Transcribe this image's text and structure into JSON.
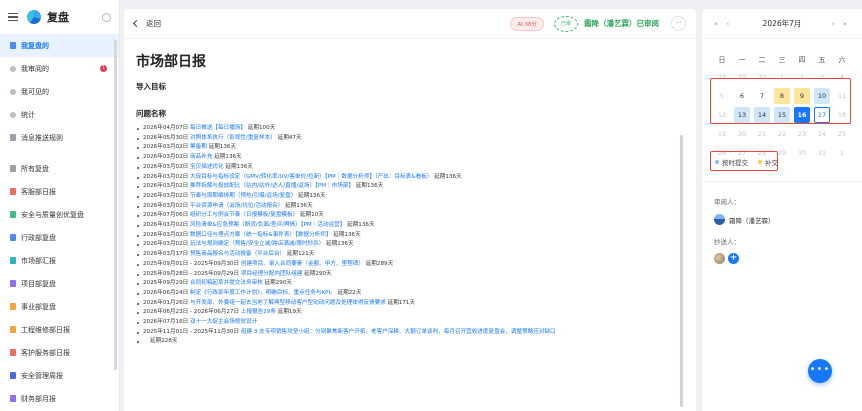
{
  "sidebar": {
    "title": "复盘",
    "items": [
      {
        "label": "我复盘的",
        "icon": "user-icon",
        "active": true
      },
      {
        "label": "我审阅的",
        "icon": "review-icon",
        "badge": "1"
      },
      {
        "label": "我可见的",
        "icon": "eye-icon"
      },
      {
        "label": "统计",
        "icon": "stats-icon"
      },
      {
        "label": "消息推送规则",
        "icon": "message-icon"
      }
    ],
    "groups": [
      {
        "label": "所有复盘",
        "icon": "grid-icon",
        "color": "gray"
      },
      {
        "label": "客服部日报",
        "icon": "doc-icon",
        "color": "red"
      },
      {
        "label": "安全与质量创优复盘",
        "icon": "doc-icon",
        "color": "green"
      },
      {
        "label": "行政部复盘",
        "icon": "doc-icon",
        "color": "blue"
      },
      {
        "label": "市场部汇报",
        "icon": "doc-icon",
        "color": "teal"
      },
      {
        "label": "项目部复盘",
        "icon": "doc-icon",
        "color": "purple"
      },
      {
        "label": "事业部复盘",
        "icon": "doc-icon",
        "color": "orange"
      },
      {
        "label": "工程维修部日报",
        "icon": "doc-icon",
        "color": "orange"
      },
      {
        "label": "客护服务部日报",
        "icon": "doc-icon",
        "color": "red"
      },
      {
        "label": "安全管理周报",
        "icon": "doc-icon",
        "color": "navy"
      },
      {
        "label": "财务部月报",
        "icon": "doc-icon",
        "color": "purple"
      }
    ]
  },
  "topbar": {
    "back_label": "返回",
    "ai_chip": "AI 38分",
    "stamp": "已审",
    "approved_text": "霜降（潘艺霖）已审阅",
    "more": "···"
  },
  "doc": {
    "title": "市场部日报",
    "section1": "导入目标",
    "section2": "问题名称",
    "items": [
      {
        "date": "2026年04月07日",
        "link": "每日推送【每日播场】",
        "delay": "延期100天"
      },
      {
        "date": "2026年05月30日",
        "link": "对照体系执行（影视性/重复样本）",
        "delay": "延期47天"
      },
      {
        "date": "2026年03月02日",
        "link": "筹备期",
        "delay": "延期136天"
      },
      {
        "date": "2026年03月02日",
        "link": "商品补充",
        "delay": "延期136天"
      },
      {
        "date": "2026年03月02日",
        "link": "宝贝描述优化",
        "delay": "延期136天"
      },
      {
        "date": "2026年03月02日",
        "link": "大促目标与指标设定（GMV/转化率/UV/客单价/拉新）【PM｜数据分析师】（产出：目标表&看板）",
        "delay": "延期136天"
      },
      {
        "date": "2026年03月02日",
        "link": "推荐拆解与投放配比（站内/站外/达人/直播/返场）【PM｜市场部】",
        "delay": "延期136天"
      },
      {
        "date": "2026年03月02日",
        "link": "节奏与周期编排期（预热/引爆/返场/复盘）",
        "delay": "延期136天"
      },
      {
        "date": "2026年03月02日",
        "link": "平台资源申请（会场/坑位/活动报名）",
        "delay": "延期136天"
      },
      {
        "date": "2026年07月06日",
        "link": "组织分工与例会节奏（日报模板/复盘模板）",
        "delay": "延期10天"
      },
      {
        "date": "2026年03月02日",
        "link": "风险清单&应急预案（断货/负面/差评/舆情）【PM｜活动运营】",
        "delay": "延期136天"
      },
      {
        "date": "2026年03月02日",
        "link": "数据口径与埋点方案（统一指标&事件表）【数据分析师】",
        "delay": "延期136天"
      },
      {
        "date": "2026年03月02日",
        "link": "玩法与规则确定（预售/安全立减/跨店满减/限时秒杀）",
        "delay": "延期136天"
      },
      {
        "date": "2026年03月17日",
        "link": "预售商品报名与活动报备（平台后台）",
        "delay": "延期121天"
      },
      {
        "date": "2025年09月01日 - 2025年09月30日",
        "link": "创建项目、录入合同要素（金额、甲方、里程碑）",
        "delay": "延期289天"
      },
      {
        "date": "2025年09月28日 - 2025年09月29日",
        "link": "项目经理分配内团队组建",
        "delay": "延期290天"
      },
      {
        "date": "2025年09月29日",
        "link": "合同初稿起草并提交法务审核",
        "delay": "延期290天"
      },
      {
        "date": "2026年06月24日",
        "link": "制定《行政部年度工作计划》，明确目标、重点任务与KPI。",
        "delay": "延期22天"
      },
      {
        "date": "2026年01月26日",
        "link": "与开发部、外委组一起去当地了解典型移动客户型动动问题及处理体得反馈要求",
        "delay": "延期171天"
      },
      {
        "date": "2026年06月23日 - 2026年06月27日",
        "link": "上报报告29条",
        "delay": "延期19天"
      },
      {
        "date": "2026年07月16日",
        "link": "双十一大促主会场视觉设计",
        "delay": ""
      },
      {
        "date": "2025年11月01日 - 2025年11月30日",
        "link": "组建 3 支专项销售攻坚小组：分别聚焦新客户开拓、老客户深耕、大额订单谈判，每月召开营收进度复盘会，调整策略应对缺口",
        "delay": ""
      }
    ],
    "last_delay": "延期228天"
  },
  "calendar": {
    "month": "2026年7月",
    "nav_prev": "« ‹",
    "nav_next": "› »",
    "weekdays": [
      "日",
      "一",
      "二",
      "三",
      "四",
      "五",
      "六"
    ],
    "rows": [
      [
        "28",
        "29",
        "30",
        "1",
        "2",
        "3",
        "4"
      ],
      [
        "5",
        "6",
        "7",
        "8",
        "9",
        "10",
        "11"
      ],
      [
        "12",
        "13",
        "14",
        "15",
        "16",
        "17",
        "18"
      ],
      [
        "19",
        "20",
        "21",
        "22",
        "23",
        "24",
        "25"
      ],
      [
        "26",
        "27",
        "28",
        "29",
        "30",
        "31",
        "1"
      ]
    ],
    "legend_ontime": "按时提交",
    "legend_late": "补交",
    "ontime_color": "#7cc3f0",
    "late_color": "#f7c948"
  },
  "people": {
    "approver_label": "审阅人：",
    "approver_name": "霜降（潘艺霖）",
    "cc_label": "抄送人："
  },
  "fab": "•••"
}
